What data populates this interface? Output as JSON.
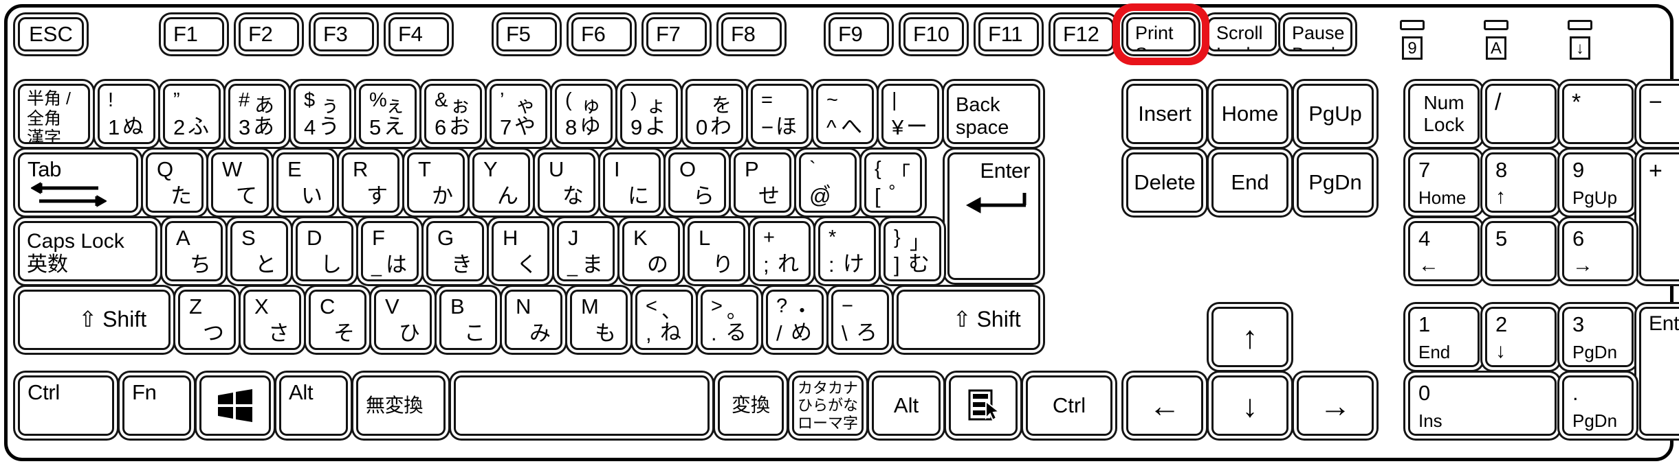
{
  "keyboard": {
    "type": "Japanese JIS 109-key full-size keyboard",
    "highlight_color": "#e8131a",
    "highlighted_key": "Print Screen"
  },
  "indicators": [
    {
      "name": "num-lock",
      "symbol": "9"
    },
    {
      "name": "caps-lock",
      "symbol": "A"
    },
    {
      "name": "scroll-lock",
      "symbol": "↓"
    }
  ],
  "function_row": {
    "esc": "ESC",
    "f_keys": [
      "F1",
      "F2",
      "F3",
      "F4",
      "F5",
      "F6",
      "F7",
      "F8",
      "F9",
      "F10",
      "F11",
      "F12"
    ],
    "print_screen": "Print\nScreen",
    "scroll_lock": "Scroll\nLock",
    "pause_break": "Pause\nBreak"
  },
  "number_row": {
    "hankaku": "半角 /\n全角\n漢字",
    "keys": [
      {
        "tl": "!",
        "tr": "",
        "bl": "1",
        "br": "ぬ"
      },
      {
        "tl": "”",
        "tr": "",
        "bl": "2",
        "br": "ふ"
      },
      {
        "tl": "#",
        "tr": "あ",
        "bl": "3",
        "br": "あ"
      },
      {
        "tl": "$",
        "tr": "ぅ",
        "bl": "4",
        "br": "う"
      },
      {
        "tl": "%",
        "tr": "ぇ",
        "bl": "5",
        "br": "え"
      },
      {
        "tl": "&",
        "tr": "ぉ",
        "bl": "6",
        "br": "お"
      },
      {
        "tl": "’",
        "tr": "ゃ",
        "bl": "7",
        "br": "や"
      },
      {
        "tl": "(",
        "tr": "ゅ",
        "bl": "8",
        "br": "ゆ"
      },
      {
        "tl": ")",
        "tr": "ょ",
        "bl": "9",
        "br": "よ"
      },
      {
        "tl": "",
        "tr": "を",
        "bl": "0",
        "br": "わ"
      },
      {
        "tl": "=",
        "tr": "",
        "bl": "−",
        "br": "ほ"
      },
      {
        "tl": "~",
        "tr": "",
        "bl": "^",
        "br": "へ"
      },
      {
        "tl": "|",
        "tr": "",
        "bl": "¥",
        "br": "ー"
      }
    ],
    "backspace": "Back\nspace"
  },
  "qwerty_row": {
    "tab": "Tab",
    "keys": [
      {
        "letter": "Q",
        "kana": "た"
      },
      {
        "letter": "W",
        "kana": "て"
      },
      {
        "letter": "E",
        "kana": "い"
      },
      {
        "letter": "R",
        "kana": "す"
      },
      {
        "letter": "T",
        "kana": "か"
      },
      {
        "letter": "Y",
        "kana": "ん"
      },
      {
        "letter": "U",
        "kana": "な"
      },
      {
        "letter": "I",
        "kana": "に"
      },
      {
        "letter": "O",
        "kana": "ら"
      },
      {
        "letter": "P",
        "kana": "せ"
      }
    ],
    "at_key": {
      "tl": "`",
      "tr": "",
      "bl": "@",
      "br": "゛"
    },
    "bracket_key": {
      "tl": "{",
      "tr": "「",
      "bl": "[",
      "br": "゜"
    },
    "enter": "Enter"
  },
  "home_row": {
    "caps_lock": "Caps Lock\n英数",
    "keys": [
      {
        "letter": "A",
        "kana": "ち"
      },
      {
        "letter": "S",
        "kana": "と"
      },
      {
        "letter": "D",
        "kana": "し"
      },
      {
        "letter": "F",
        "kana": "は",
        "mark": "_"
      },
      {
        "letter": "G",
        "kana": "き"
      },
      {
        "letter": "H",
        "kana": "く"
      },
      {
        "letter": "J",
        "kana": "ま",
        "mark": "_"
      },
      {
        "letter": "K",
        "kana": "の"
      },
      {
        "letter": "L",
        "kana": "り"
      }
    ],
    "semicolon": {
      "tl": "+",
      "tr": "",
      "bl": ";",
      "br": "れ"
    },
    "colon": {
      "tl": "*",
      "tr": "",
      "bl": ":",
      "br": "け"
    },
    "rbracket": {
      "tl": "}",
      "tr": "」",
      "bl": "]",
      "br": "む"
    }
  },
  "shift_row": {
    "shift_left": "Shift",
    "shift_right": "Shift",
    "shift_icon": "⇧",
    "keys": [
      {
        "letter": "Z",
        "kana": "つ"
      },
      {
        "letter": "X",
        "kana": "さ"
      },
      {
        "letter": "C",
        "kana": "そ"
      },
      {
        "letter": "V",
        "kana": "ひ"
      },
      {
        "letter": "B",
        "kana": "こ"
      },
      {
        "letter": "N",
        "kana": "み"
      },
      {
        "letter": "M",
        "kana": "も"
      }
    ],
    "comma": {
      "tl": "<",
      "tr": "、",
      "bl": ",",
      "br": "ね"
    },
    "period": {
      "tl": ">",
      "tr": "。",
      "bl": ".",
      "br": "る"
    },
    "slash": {
      "tl": "?",
      "tr": "・",
      "bl": "/",
      "br": "め"
    },
    "backslash": {
      "tl": "−",
      "tr": "",
      "bl": "\\",
      "br": "ろ"
    }
  },
  "bottom_row": {
    "ctrl_left": "Ctrl",
    "fn": "Fn",
    "win_icon": "windows-logo",
    "alt_left": "Alt",
    "muhenkan": "無変換",
    "space": "",
    "henkan": "変換",
    "katakana": "カタカナ\nひらがな\nローマ字",
    "alt_right": "Alt",
    "menu_icon": "context-menu",
    "ctrl_right": "Ctrl"
  },
  "nav_cluster": {
    "insert": "Insert",
    "home": "Home",
    "pgup": "PgUp",
    "delete": "Delete",
    "end": "End",
    "pgdn": "PgDn",
    "arrow_up": "↑",
    "arrow_left": "←",
    "arrow_down": "↓",
    "arrow_right": "→"
  },
  "numpad": {
    "num_lock": "Num\nLock",
    "divide": "/",
    "multiply": "*",
    "minus": "−",
    "plus": "+",
    "enter": "Enter",
    "k7": {
      "num": "7",
      "sub": "Home"
    },
    "k8": {
      "num": "8",
      "sub": "↑"
    },
    "k9": {
      "num": "9",
      "sub": "PgUp"
    },
    "k4": {
      "num": "4",
      "sub": "←"
    },
    "k5": {
      "num": "5",
      "sub": ""
    },
    "k6": {
      "num": "6",
      "sub": "→"
    },
    "k1": {
      "num": "1",
      "sub": "End"
    },
    "k2": {
      "num": "2",
      "sub": "↓"
    },
    "k3": {
      "num": "3",
      "sub": "PgDn"
    },
    "k0": {
      "num": "0",
      "sub": "Ins"
    },
    "kdot": {
      "num": ".",
      "sub": "PgDn"
    }
  }
}
